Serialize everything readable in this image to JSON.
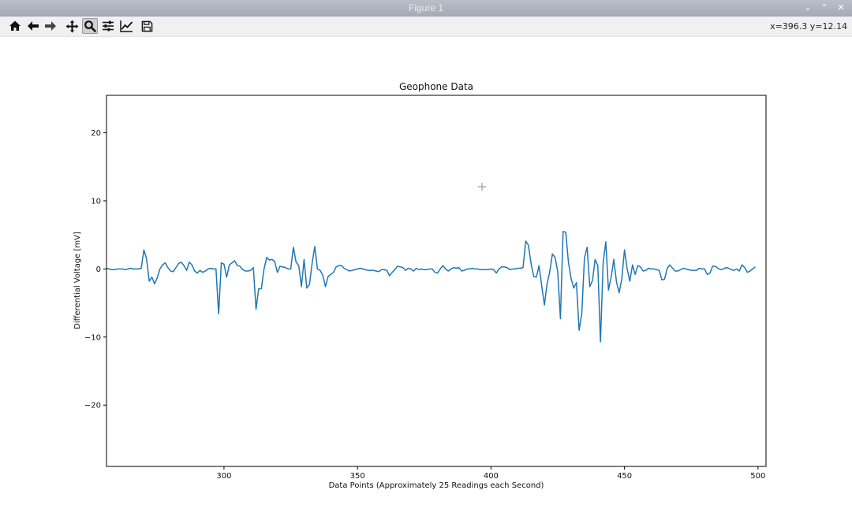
{
  "window": {
    "title": "Figure 1"
  },
  "toolbar": {
    "buttons": [
      {
        "name": "home-button",
        "icon": "home-icon"
      },
      {
        "name": "back-button",
        "icon": "arrow-left-icon"
      },
      {
        "name": "forward-button",
        "icon": "arrow-right-icon"
      },
      {
        "name": "pan-button",
        "icon": "move-icon"
      },
      {
        "name": "zoom-button",
        "icon": "magnifier-icon",
        "active": true
      },
      {
        "name": "subplots-button",
        "icon": "sliders-icon"
      },
      {
        "name": "edit-axes-button",
        "icon": "line-chart-icon"
      },
      {
        "name": "save-button",
        "icon": "floppy-disk-icon"
      }
    ],
    "coordinates": "x=396.3 y=12.14"
  },
  "chart_data": {
    "type": "line",
    "title": "Geophone Data",
    "xlabel": "Data Points (Approximately 25 Readings each Second)",
    "ylabel": "Differential Voltage [mV]",
    "xlim": [
      256,
      503
    ],
    "ylim": [
      -29,
      25.5
    ],
    "xticks": [
      300,
      350,
      400,
      450,
      500
    ],
    "yticks": [
      20,
      10,
      0,
      -10,
      -20
    ],
    "xtick_labels": [
      "300",
      "350",
      "400",
      "450",
      "500"
    ],
    "ytick_labels": [
      "20",
      "10",
      "0",
      "−10",
      "−20"
    ],
    "line_color": "#1f77b4",
    "grid": false,
    "series": [
      {
        "x": [
          256,
          257,
          258,
          259,
          260,
          261,
          262,
          263,
          264,
          265,
          266,
          267,
          268,
          269,
          270,
          271,
          272,
          273,
          274,
          275,
          276,
          277,
          278,
          279,
          280,
          281,
          282,
          283,
          284,
          285,
          286,
          287,
          288,
          289,
          290,
          291,
          292,
          293,
          294,
          295,
          296,
          297,
          298,
          299,
          300,
          301,
          302,
          303,
          304,
          305,
          306,
          307,
          308,
          309,
          310,
          311,
          312,
          313,
          314,
          315,
          316,
          317,
          318,
          319,
          320,
          321,
          322,
          323,
          324,
          325,
          326,
          327,
          328,
          329,
          330,
          331,
          332,
          333,
          334,
          335,
          336,
          337,
          338,
          339,
          340,
          341,
          342,
          343,
          344,
          345,
          346,
          347,
          348,
          349,
          350,
          351,
          352,
          353,
          354,
          355,
          356,
          357,
          358,
          359,
          360,
          361,
          362,
          363,
          364,
          365,
          366,
          367,
          368,
          369,
          370,
          371,
          372,
          373,
          374,
          375,
          376,
          377,
          378,
          379,
          380,
          381,
          382,
          383,
          384,
          385,
          386,
          387,
          388,
          389,
          390,
          391,
          392,
          393,
          394,
          395,
          396,
          397,
          398,
          399,
          400,
          401,
          402,
          403,
          404,
          405,
          406,
          407,
          408,
          409,
          410,
          411,
          412,
          413,
          414,
          415,
          416,
          417,
          418,
          419,
          420,
          421,
          422,
          423,
          424,
          425,
          426,
          427,
          428,
          429,
          430,
          431,
          432,
          433,
          434,
          435,
          436,
          437,
          438,
          439,
          440,
          441,
          442,
          443,
          444,
          445,
          446,
          447,
          448,
          449,
          450,
          451,
          452,
          453,
          454,
          455,
          456,
          457,
          458,
          459,
          460,
          461,
          462,
          463,
          464,
          465,
          466,
          467,
          468,
          469,
          470,
          471,
          472,
          473,
          474,
          475,
          476,
          477,
          478,
          479,
          480,
          481,
          482,
          483,
          484,
          485,
          486,
          487,
          488,
          489,
          490,
          491,
          492,
          493,
          494,
          495,
          496,
          497,
          498,
          499
        ],
        "y": [
          0.1,
          0.0,
          -0.1,
          -0.1,
          0.0,
          0.0,
          0.0,
          -0.1,
          0.0,
          0.1,
          0.0,
          0.0,
          0.0,
          0.1,
          2.8,
          1.5,
          -1.8,
          -1.2,
          -2.2,
          -1.3,
          0.0,
          0.6,
          0.9,
          0.2,
          -0.3,
          -0.4,
          0.2,
          0.8,
          1.0,
          0.5,
          -0.2,
          1.0,
          0.6,
          -0.3,
          -0.6,
          -0.2,
          -0.5,
          -0.3,
          0.0,
          0.1,
          0.0,
          0.0,
          -6.6,
          0.9,
          0.7,
          -1.2,
          0.6,
          0.9,
          1.2,
          0.5,
          0.4,
          -0.1,
          -0.3,
          -0.3,
          -0.2,
          0.2,
          -5.9,
          -2.9,
          -2.9,
          0.0,
          1.7,
          1.3,
          1.4,
          1.1,
          -0.5,
          0.4,
          0.3,
          0.2,
          0.0,
          0.0,
          3.2,
          1.0,
          0.5,
          -2.6,
          1.4,
          -2.8,
          -2.3,
          0.8,
          3.3,
          0.0,
          -0.2,
          -0.9,
          -2.6,
          -1.1,
          -0.8,
          -0.5,
          0.3,
          0.5,
          0.5,
          0.1,
          -0.1,
          -0.3,
          -0.2,
          -0.1,
          0.0,
          0.1,
          0.0,
          -0.1,
          -0.2,
          -0.2,
          -0.2,
          -0.3,
          -0.4,
          -0.1,
          -0.1,
          -0.2,
          -1.0,
          -0.5,
          -0.1,
          0.4,
          0.3,
          0.2,
          -0.2,
          0.1,
          0.0,
          -0.3,
          0.1,
          -0.1,
          0.0,
          -0.1,
          -0.1,
          0.0,
          0.0,
          -0.5,
          -0.6,
          0.0,
          0.5,
          0.0,
          -0.3,
          0.0,
          0.2,
          0.1,
          0.2,
          -0.3,
          -0.2,
          0.0,
          0.0,
          0.1,
          0.0,
          0.0,
          -0.1,
          -0.1,
          -0.1,
          -0.1,
          0.0,
          -0.1,
          -0.6,
          0.0,
          0.3,
          0.3,
          0.2,
          -0.1,
          0.0,
          0.0,
          0.1,
          0.1,
          0.2,
          4.1,
          3.5,
          0.8,
          -1.1,
          -1.2,
          0.5,
          -2.5,
          -5.3,
          -2.2,
          -0.4,
          2.2,
          1.7,
          -0.4,
          -7.3,
          5.5,
          5.4,
          1.0,
          -1.4,
          -2.8,
          -2.0,
          -9.0,
          -6.6,
          1.6,
          3.2,
          -2.6,
          -1.7,
          1.4,
          0.5,
          -10.7,
          0.9,
          4.0,
          -3.1,
          -1.2,
          1.4,
          -1.9,
          -3.5,
          -1.4,
          2.8,
          0.0,
          -1.8,
          0.6,
          -0.8,
          0.5,
          0.3,
          -0.3,
          -0.2,
          0.1,
          0.0,
          0.0,
          -0.1,
          -0.2,
          -1.6,
          -1.5,
          0.1,
          0.6,
          0.1,
          -0.3,
          -0.3,
          -0.1,
          0.1,
          0.0,
          -0.1,
          -0.2,
          -0.2,
          -0.2,
          0.1,
          0.0,
          0.0,
          -0.8,
          -0.6,
          0.4,
          0.4,
          0.1,
          -0.1,
          0.0,
          0.2,
          0.1,
          -0.1,
          -0.2,
          0.0,
          -0.3,
          0.6,
          0.2,
          -0.5,
          -0.3,
          0.0,
          0.3
        ]
      }
    ]
  }
}
